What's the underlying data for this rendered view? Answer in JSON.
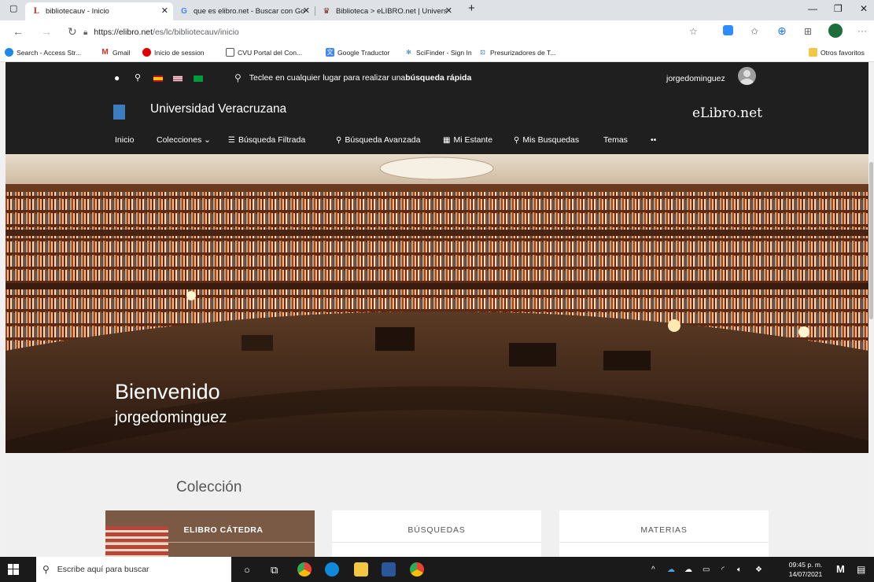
{
  "browser": {
    "tabs": [
      {
        "title": "bibliotecauv - Inicio",
        "active": true
      },
      {
        "title": "que es elibro.net - Buscar con Go",
        "active": false
      },
      {
        "title": "Biblioteca > eLIBRO.net | Univers",
        "active": false
      }
    ],
    "new_tab_symbol": "+",
    "url_host": "https://elibro.net",
    "url_path": "/es/lc/bibliotecauv/inicio",
    "bookmarks": [
      "Search - Access Str...",
      "Gmail",
      "Inicio de session",
      "CVU Portal del Con...",
      "Google Traductor",
      "SciFinder - Sign In",
      "Presurizadores de T..."
    ],
    "other_favorites": "Otros favoritos"
  },
  "site": {
    "quick_search_prefix": "Teclee en cualquier lugar para realizar una ",
    "quick_search_bold": "búsqueda rápida",
    "username": "jorgedominguez",
    "university": "Universidad Veracruzana",
    "brand": "eLibro.net",
    "menu": [
      {
        "label": "Inicio",
        "icon": ""
      },
      {
        "label": "Colecciones  ⌄",
        "icon": ""
      },
      {
        "label": "Búsqueda Filtrada",
        "icon": "filter-icon"
      },
      {
        "label": "Búsqueda Avanzada",
        "icon": "search-icon"
      },
      {
        "label": "Mi Estante",
        "icon": "shelf-icon"
      },
      {
        "label": "Mis Busquedas",
        "icon": "search-icon"
      },
      {
        "label": "Temas",
        "icon": ""
      },
      {
        "label": "••",
        "icon": ""
      }
    ]
  },
  "hero": {
    "welcome": "Bienvenido",
    "user": "jorgedominguez"
  },
  "collection": {
    "title": "Colección",
    "cards": [
      {
        "title": "ELIBRO CÁTEDRA"
      },
      {
        "title": "BÚSQUEDAS"
      },
      {
        "title": "MATERIAS"
      }
    ]
  },
  "taskbar": {
    "search_placeholder": "Escribe aquí para buscar",
    "time": "09:45 p. m.",
    "date": "14/07/2021"
  },
  "colors": {
    "site_header": "#1f1f1f",
    "tab_bar": "#dee1e6",
    "taskbar": "#1a1a1a"
  }
}
